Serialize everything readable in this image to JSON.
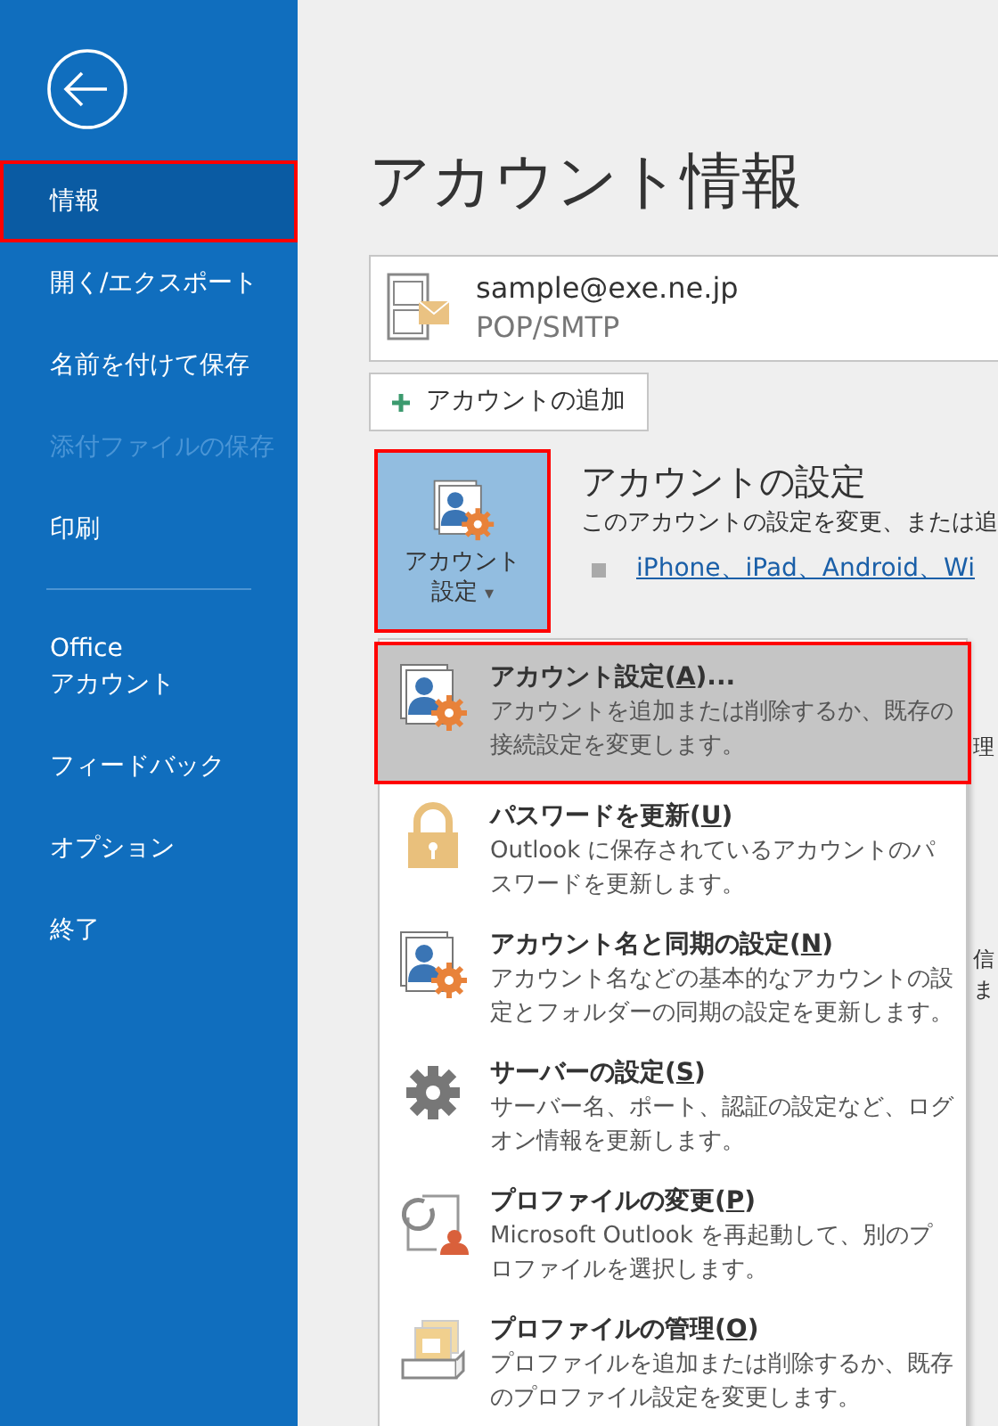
{
  "sidebar": {
    "items": [
      {
        "kind": "item",
        "label": "情報",
        "selected": true,
        "disabled": false
      },
      {
        "kind": "item",
        "label": "開く/エクスポート",
        "selected": false,
        "disabled": false
      },
      {
        "kind": "item",
        "label": "名前を付けて保存",
        "selected": false,
        "disabled": false
      },
      {
        "kind": "item",
        "label": "添付ファイルの保存",
        "selected": false,
        "disabled": true
      },
      {
        "kind": "item",
        "label": "印刷",
        "selected": false,
        "disabled": false
      },
      {
        "kind": "divider"
      },
      {
        "kind": "item",
        "label": "Office\nアカウント",
        "selected": false,
        "disabled": false
      },
      {
        "kind": "item",
        "label": "フィードバック",
        "selected": false,
        "disabled": false
      },
      {
        "kind": "item",
        "label": "オプション",
        "selected": false,
        "disabled": false
      },
      {
        "kind": "item",
        "label": "終了",
        "selected": false,
        "disabled": false
      }
    ]
  },
  "page_title": "アカウント情報",
  "account": {
    "email": "sample@exe.ne.jp",
    "type": "POP/SMTP"
  },
  "add_account_button": "アカウントの追加",
  "account_settings": {
    "button_label": "アカウント設定",
    "caret": "▾",
    "selected": true,
    "heading": "アカウントの設定",
    "description": "このアカウントの設定を変更、または追",
    "link": "iPhone、iPad、Android、Wi"
  },
  "background_fragments": [
    "理",
    "信",
    "ま"
  ],
  "menu": {
    "items": [
      {
        "kind": "account",
        "before": "アカウント設定(",
        "key": "A",
        "after": ")...",
        "description": "アカウントを追加または削除するか、既存の接続設定を変更します。",
        "selected": true
      },
      {
        "kind": "lock",
        "before": "パスワードを更新(",
        "key": "U",
        "after": ")",
        "description": "Outlook に保存されているアカウントのパスワードを更新します。",
        "selected": false
      },
      {
        "kind": "account",
        "before": "アカウント名と同期の設定(",
        "key": "N",
        "after": ")",
        "description": "アカウント名などの基本的なアカウントの設定とフォルダーの同期の設定を更新します。",
        "selected": false
      },
      {
        "kind": "server",
        "before": "サーバーの設定(",
        "key": "S",
        "after": ")",
        "description": "サーバー名、ポート、認証の設定など、ログオン情報を更新します。",
        "selected": false
      },
      {
        "kind": "profile_change",
        "before": "プロファイルの変更(",
        "key": "P",
        "after": ")",
        "description": "Microsoft Outlook を再起動して、別のプロファイルを選択します。",
        "selected": false
      },
      {
        "kind": "profile_manage",
        "before": "プロファイルの管理(",
        "key": "O",
        "after": ")",
        "description": "プロファイルを追加または削除するか、既存のプロファイル設定を変更します。",
        "selected": false
      }
    ]
  }
}
